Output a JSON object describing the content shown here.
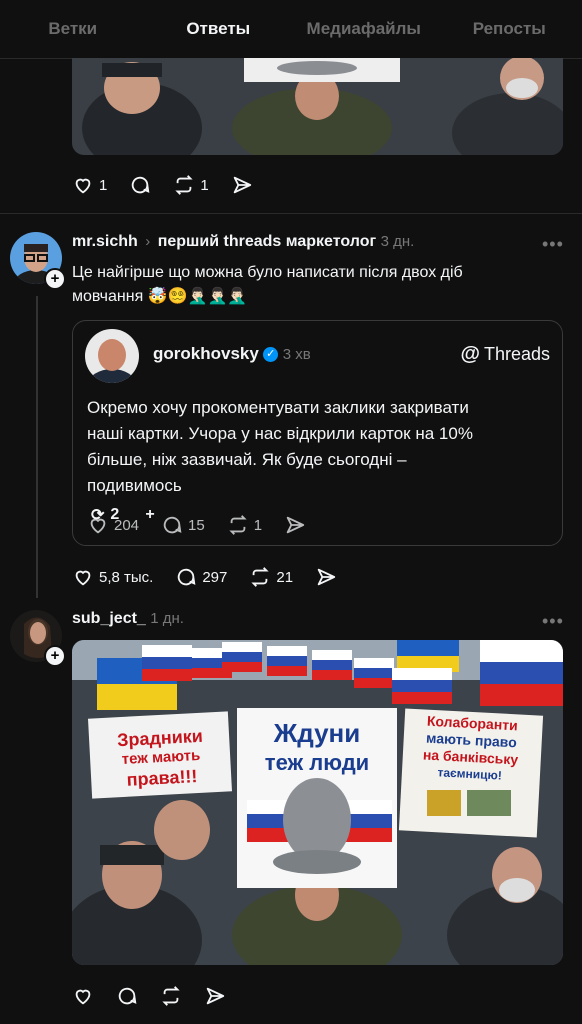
{
  "tabs": [
    "Ветки",
    "Ответы",
    "Медиафайлы",
    "Репосты"
  ],
  "active_tab": 1,
  "post1": {
    "likes": "1",
    "comments": "",
    "reposts": "1"
  },
  "post2": {
    "username": "mr.sichh",
    "reply_to": "перший threads маркетолог",
    "time": "3 дн.",
    "text_line1": "Це найгірше що можна було написати після двох діб",
    "text_line2": "мовчання 🤯😵‍💫🤦🏻‍♂️🤦🏻‍♂️🤦🏻‍♂️",
    "likes": "5,8 тыс.",
    "comments": "297",
    "reposts": "21"
  },
  "quote": {
    "username": "gorokhovsky",
    "time": "3 хв",
    "brand": "Threads",
    "text": [
      "Окремо хочу прокоментувати заклики закривати",
      "наші картки. Учора у нас відкрили карток на 10%",
      "більше, ніж зазвичай. Як буде сьогодні –",
      "подивимось"
    ],
    "overlay_count": "2",
    "overlay_plus": "+",
    "likes": "204",
    "comments": "15",
    "reposts": "1"
  },
  "post3": {
    "username": "sub_ject_",
    "time": "1 дн."
  },
  "poster": {
    "left": [
      "Зрадники",
      "теж мають",
      "права!!!"
    ],
    "center": [
      "Ждуни",
      "теж люди"
    ],
    "right": [
      "Колаборанти",
      "мають право",
      "на банківську",
      "таємницю!"
    ]
  },
  "colors": {
    "bg": "#101010",
    "text": "#f3f5f7",
    "muted": "#777777",
    "verified": "#0095f6"
  }
}
